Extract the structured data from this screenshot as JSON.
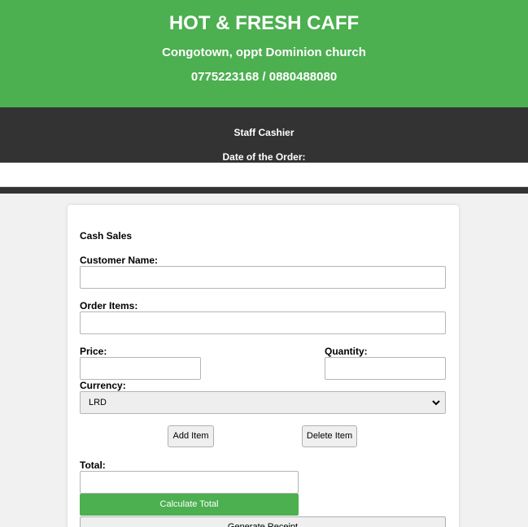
{
  "header": {
    "title": "HOT & FRESH CAFF",
    "address": "Congotown, oppt Dominion church",
    "phone": "0775223168 / 0880488080"
  },
  "topbar": {
    "staff": "Staff Cashier",
    "date_label": "Date of the Order:",
    "date_value": ""
  },
  "colors": {
    "brand_green": "#4caf50",
    "dark_bar": "#333333",
    "page_bg": "#f1f1f1"
  },
  "form": {
    "section_title": "Cash Sales",
    "customer_label": "Customer Name:",
    "customer_value": "",
    "items_label": "Order Items:",
    "items_value": "",
    "price_label": "Price:",
    "price_value": "",
    "quantity_label": "Quantity:",
    "quantity_value": "",
    "currency_label": "Currency:",
    "currency_selected": "LRD",
    "add_item_label": "Add Item",
    "delete_item_label": "Delete Item",
    "total_label": "Total:",
    "total_value": "",
    "calculate_label": "Calculate Total",
    "receipt_label": "Generate Receipt"
  }
}
